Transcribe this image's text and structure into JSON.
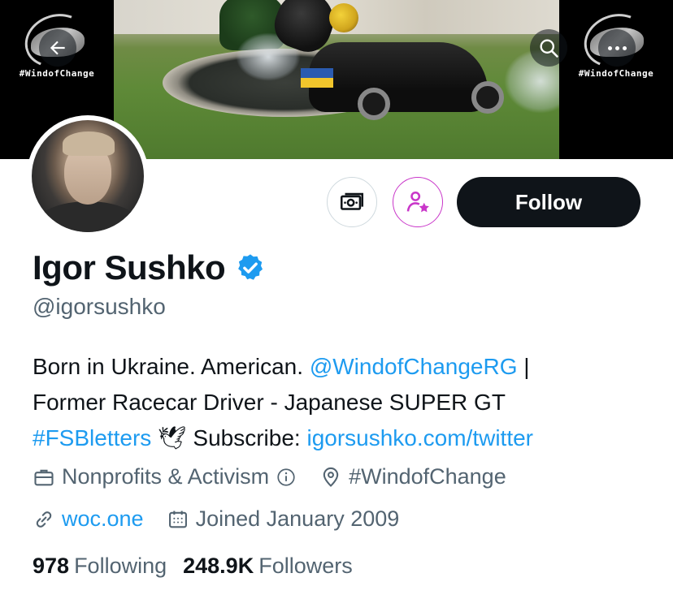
{
  "banner": {
    "brand_tag_left": "#WindofChange",
    "brand_tag_right": "#WindofChange"
  },
  "actions": {
    "follow_label": "Follow"
  },
  "profile": {
    "name": "Igor Sushko",
    "handle": "@igorsushko",
    "bio": {
      "line1_text": "Born in Ukraine. American.",
      "line1_mention": "@WindofChangeRG",
      "line1_sep": "|",
      "line2_text": "Former Racecar Driver - Japanese SUPER GT",
      "line3_hashtag": "#FSBletters",
      "line3_emoji": "🕊",
      "line3_text": "Subscribe:",
      "line3_link": "igorsushko.com/twitter"
    },
    "category": "Nonprofits & Activism",
    "location": "#WindofChange",
    "website": "woc.one",
    "joined": "Joined January 2009"
  },
  "stats": {
    "following_count": "978",
    "following_label": "Following",
    "followers_count": "248.9K",
    "followers_label": "Followers"
  },
  "colors": {
    "link": "#1d9bf0",
    "verified": "#1d9bf0",
    "subscribe_accent": "#c936c9",
    "follow_bg": "#0f1419",
    "secondary_text": "#536471"
  },
  "icons": {
    "back": "arrow-left-icon",
    "search": "search-icon",
    "more": "more-dots-icon",
    "tip": "money-icon",
    "subscribe": "person-star-icon",
    "verified": "verified-badge-icon",
    "category": "briefcase-icon",
    "info": "info-icon",
    "location": "location-pin-icon",
    "link": "link-icon",
    "calendar": "calendar-icon"
  }
}
